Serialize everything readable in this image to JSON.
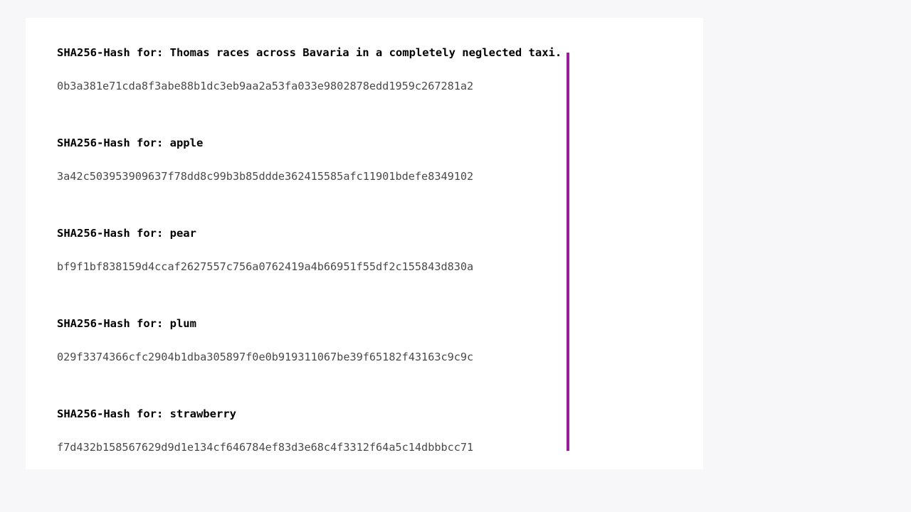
{
  "page": {
    "background_color": "#f7f6f9",
    "card_background_color": "#ffffff"
  },
  "accent": {
    "name": "vertical-accent-bar",
    "color": "#9b1c9b",
    "orientation": "vertical"
  },
  "document": {
    "label_prefix": "SHA256-Hash for:",
    "entries": [
      {
        "label": "SHA256-Hash for: Thomas races across Bavaria in a completely neglected taxi.",
        "input": "Thomas races across Bavaria in a completely neglected taxi.",
        "hash": "0b3a381e71cda8f3abe88b1dc3eb9aa2a53fa033e9802878edd1959c267281a2"
      },
      {
        "label": "SHA256-Hash for: apple",
        "input": "apple",
        "hash": "3a42c503953909637f78dd8c99b3b85ddde362415585afc11901bdefe8349102"
      },
      {
        "label": "SHA256-Hash for: pear",
        "input": "pear",
        "hash": "bf9f1bf838159d4ccaf2627557c756a0762419a4b66951f55df2c155843d830a"
      },
      {
        "label": "SHA256-Hash for: plum",
        "input": "plum",
        "hash": "029f3374366cfc2904b1dba305897f0e0b919311067be39f65182f43163c9c9c"
      },
      {
        "label": "SHA256-Hash for: strawberry",
        "input": "strawberry",
        "hash": "f7d432b158567629d9d1e134cf646784ef83d3e68c4f3312f64a5c14dbbbcc71"
      }
    ]
  }
}
